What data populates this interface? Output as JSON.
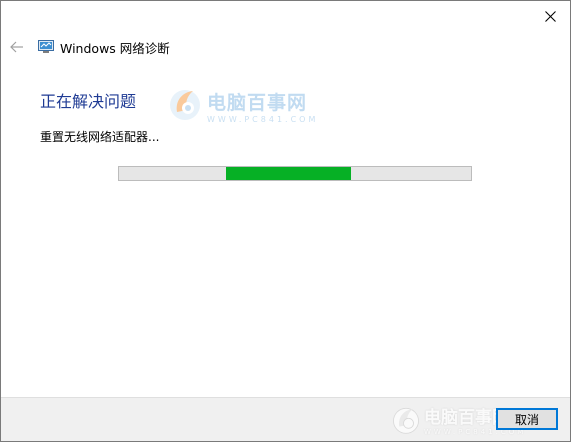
{
  "window": {
    "title": "Windows 网络诊断",
    "app_icon": "network-diagnostics-icon",
    "close_icon": "close-icon",
    "back_icon": "back-arrow-icon"
  },
  "main": {
    "heading": "正在解决问题",
    "status": "重置无线网络适配器...",
    "progress": {
      "state": "indeterminate (marquee)",
      "visible_segment_start_fraction": 0.305,
      "visible_segment_end_fraction": 0.66
    }
  },
  "watermark": {
    "main_text": "电脑百事网",
    "sub_text": "WWW.PC841.COM",
    "logo_icon": "pc841-logo-icon"
  },
  "footer": {
    "cancel_label": "取消"
  },
  "colors": {
    "heading": "#1f3b94",
    "progress_fill": "#06b025",
    "progress_track": "#e6e6e6",
    "footer_bg": "#f0f0f0",
    "button_border": "#0078d7"
  }
}
